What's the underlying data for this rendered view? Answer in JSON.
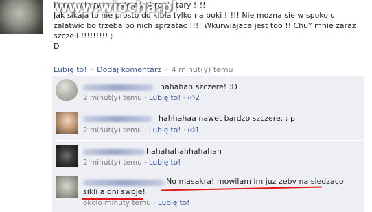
{
  "watermark": "www.wiocha.pl",
  "post": {
    "text": "Kurw* wkurwia mnie moj brat i stary !!!!\nJak sikaja to nie prosto do kibla tylko na boki !!!!! Nie mozna sie w spokoju zalatwic bo trzeba po nich sprzatac !!!! Wkurwiajace jest too !! Chu* mnie zaraz szczeli !!!!!!!!! ;\nD",
    "like_label": "Lubię to!",
    "comment_label": "Dodaj komentarz",
    "time": "4 minut(y) temu",
    "separator": "·"
  },
  "comments": [
    {
      "text": "hahahah szczere! :D",
      "time": "2 minut(y) temu",
      "separator": "·",
      "like_label": "Lubię to!",
      "likes_count": "2",
      "like_icon": "thumbs-up-icon"
    },
    {
      "text": "hahhahaa nawet bardzo szczere. ; p",
      "time": "2 minut(y) temu",
      "separator": "·",
      "like_label": "Lubię to!",
      "likes_count": "1",
      "like_icon": "thumbs-up-icon"
    },
    {
      "text": "hahahahahhahahah",
      "time": "2 minut(y) temu",
      "separator": "·",
      "like_label": "Lubię to!"
    },
    {
      "text_line1": "No masakra! mowilam im juz zeby na siedzaco",
      "text_line2": "sikli a oni swoje!",
      "time": "około minuty temu",
      "separator": "·",
      "like_label": "Lubię to!"
    }
  ],
  "colors": {
    "link": "#3b5998",
    "comment_bg": "#edeff4",
    "highlight_underline": "#e21818"
  }
}
